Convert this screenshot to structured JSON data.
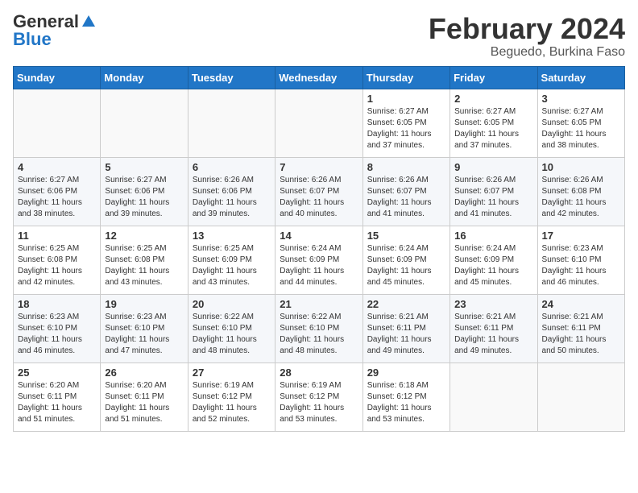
{
  "header": {
    "logo_general": "General",
    "logo_blue": "Blue",
    "title": "February 2024",
    "location": "Beguedo, Burkina Faso"
  },
  "weekdays": [
    "Sunday",
    "Monday",
    "Tuesday",
    "Wednesday",
    "Thursday",
    "Friday",
    "Saturday"
  ],
  "weeks": [
    [
      {
        "day": "",
        "info": ""
      },
      {
        "day": "",
        "info": ""
      },
      {
        "day": "",
        "info": ""
      },
      {
        "day": "",
        "info": ""
      },
      {
        "day": "1",
        "info": "Sunrise: 6:27 AM\nSunset: 6:05 PM\nDaylight: 11 hours\nand 37 minutes."
      },
      {
        "day": "2",
        "info": "Sunrise: 6:27 AM\nSunset: 6:05 PM\nDaylight: 11 hours\nand 37 minutes."
      },
      {
        "day": "3",
        "info": "Sunrise: 6:27 AM\nSunset: 6:05 PM\nDaylight: 11 hours\nand 38 minutes."
      }
    ],
    [
      {
        "day": "4",
        "info": "Sunrise: 6:27 AM\nSunset: 6:06 PM\nDaylight: 11 hours\nand 38 minutes."
      },
      {
        "day": "5",
        "info": "Sunrise: 6:27 AM\nSunset: 6:06 PM\nDaylight: 11 hours\nand 39 minutes."
      },
      {
        "day": "6",
        "info": "Sunrise: 6:26 AM\nSunset: 6:06 PM\nDaylight: 11 hours\nand 39 minutes."
      },
      {
        "day": "7",
        "info": "Sunrise: 6:26 AM\nSunset: 6:07 PM\nDaylight: 11 hours\nand 40 minutes."
      },
      {
        "day": "8",
        "info": "Sunrise: 6:26 AM\nSunset: 6:07 PM\nDaylight: 11 hours\nand 41 minutes."
      },
      {
        "day": "9",
        "info": "Sunrise: 6:26 AM\nSunset: 6:07 PM\nDaylight: 11 hours\nand 41 minutes."
      },
      {
        "day": "10",
        "info": "Sunrise: 6:26 AM\nSunset: 6:08 PM\nDaylight: 11 hours\nand 42 minutes."
      }
    ],
    [
      {
        "day": "11",
        "info": "Sunrise: 6:25 AM\nSunset: 6:08 PM\nDaylight: 11 hours\nand 42 minutes."
      },
      {
        "day": "12",
        "info": "Sunrise: 6:25 AM\nSunset: 6:08 PM\nDaylight: 11 hours\nand 43 minutes."
      },
      {
        "day": "13",
        "info": "Sunrise: 6:25 AM\nSunset: 6:09 PM\nDaylight: 11 hours\nand 43 minutes."
      },
      {
        "day": "14",
        "info": "Sunrise: 6:24 AM\nSunset: 6:09 PM\nDaylight: 11 hours\nand 44 minutes."
      },
      {
        "day": "15",
        "info": "Sunrise: 6:24 AM\nSunset: 6:09 PM\nDaylight: 11 hours\nand 45 minutes."
      },
      {
        "day": "16",
        "info": "Sunrise: 6:24 AM\nSunset: 6:09 PM\nDaylight: 11 hours\nand 45 minutes."
      },
      {
        "day": "17",
        "info": "Sunrise: 6:23 AM\nSunset: 6:10 PM\nDaylight: 11 hours\nand 46 minutes."
      }
    ],
    [
      {
        "day": "18",
        "info": "Sunrise: 6:23 AM\nSunset: 6:10 PM\nDaylight: 11 hours\nand 46 minutes."
      },
      {
        "day": "19",
        "info": "Sunrise: 6:23 AM\nSunset: 6:10 PM\nDaylight: 11 hours\nand 47 minutes."
      },
      {
        "day": "20",
        "info": "Sunrise: 6:22 AM\nSunset: 6:10 PM\nDaylight: 11 hours\nand 48 minutes."
      },
      {
        "day": "21",
        "info": "Sunrise: 6:22 AM\nSunset: 6:10 PM\nDaylight: 11 hours\nand 48 minutes."
      },
      {
        "day": "22",
        "info": "Sunrise: 6:21 AM\nSunset: 6:11 PM\nDaylight: 11 hours\nand 49 minutes."
      },
      {
        "day": "23",
        "info": "Sunrise: 6:21 AM\nSunset: 6:11 PM\nDaylight: 11 hours\nand 49 minutes."
      },
      {
        "day": "24",
        "info": "Sunrise: 6:21 AM\nSunset: 6:11 PM\nDaylight: 11 hours\nand 50 minutes."
      }
    ],
    [
      {
        "day": "25",
        "info": "Sunrise: 6:20 AM\nSunset: 6:11 PM\nDaylight: 11 hours\nand 51 minutes."
      },
      {
        "day": "26",
        "info": "Sunrise: 6:20 AM\nSunset: 6:11 PM\nDaylight: 11 hours\nand 51 minutes."
      },
      {
        "day": "27",
        "info": "Sunrise: 6:19 AM\nSunset: 6:12 PM\nDaylight: 11 hours\nand 52 minutes."
      },
      {
        "day": "28",
        "info": "Sunrise: 6:19 AM\nSunset: 6:12 PM\nDaylight: 11 hours\nand 53 minutes."
      },
      {
        "day": "29",
        "info": "Sunrise: 6:18 AM\nSunset: 6:12 PM\nDaylight: 11 hours\nand 53 minutes."
      },
      {
        "day": "",
        "info": ""
      },
      {
        "day": "",
        "info": ""
      }
    ]
  ]
}
